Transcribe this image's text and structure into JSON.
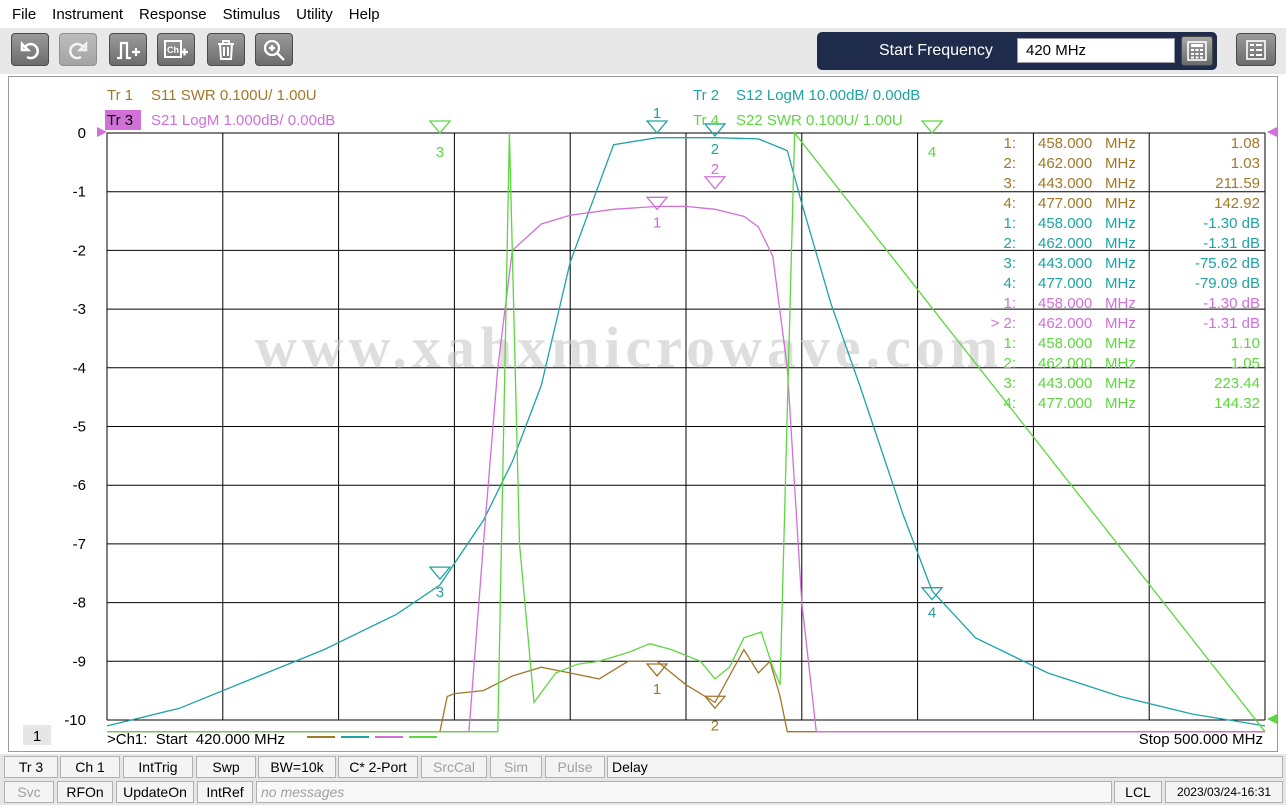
{
  "menu": [
    "File",
    "Instrument",
    "Response",
    "Stimulus",
    "Utility",
    "Help"
  ],
  "toolbar": {
    "buttons": [
      "undo-icon",
      "redo-icon",
      "marker-icon",
      "channel-icon",
      "trash-icon",
      "zoom-icon"
    ],
    "start_label": "Start Frequency",
    "start_value": "420 MHz"
  },
  "traces": {
    "tr1": {
      "id": "Tr  1",
      "desc": "S11 SWR 0.100U/  1.00U",
      "color": "#a0782a"
    },
    "tr2": {
      "id": "Tr  2",
      "desc": "S12 LogM 10.00dB/  0.00dB",
      "color": "#1fa3a3"
    },
    "tr3": {
      "id": "Tr  3",
      "desc": "S21 LogM 1.000dB/  0.00dB",
      "color": "#d070d8"
    },
    "tr4": {
      "id": "Tr  4",
      "desc": "S22 SWR 0.100U/  1.00U",
      "color": "#5ed640"
    }
  },
  "yticks": [
    "0",
    "-1",
    "-2",
    "-3",
    "-4",
    "-5",
    "-6",
    "-7",
    "-8",
    "-9",
    "-10"
  ],
  "marker_table": [
    {
      "n": "1:",
      "f": "458.000",
      "u": "MHz",
      "v": "1.08",
      "c": "#a0782a"
    },
    {
      "n": "2:",
      "f": "462.000",
      "u": "MHz",
      "v": "1.03",
      "c": "#a0782a"
    },
    {
      "n": "3:",
      "f": "443.000",
      "u": "MHz",
      "v": "211.59",
      "c": "#a0782a"
    },
    {
      "n": "4:",
      "f": "477.000",
      "u": "MHz",
      "v": "142.92",
      "c": "#a0782a"
    },
    {
      "n": "1:",
      "f": "458.000",
      "u": "MHz",
      "v": "-1.30 dB",
      "c": "#1fa3a3"
    },
    {
      "n": "2:",
      "f": "462.000",
      "u": "MHz",
      "v": "-1.31 dB",
      "c": "#1fa3a3"
    },
    {
      "n": "3:",
      "f": "443.000",
      "u": "MHz",
      "v": "-75.62 dB",
      "c": "#1fa3a3"
    },
    {
      "n": "4:",
      "f": "477.000",
      "u": "MHz",
      "v": "-79.09 dB",
      "c": "#1fa3a3"
    },
    {
      "n": "1:",
      "f": "458.000",
      "u": "MHz",
      "v": "-1.30 dB",
      "c": "#d070d8"
    },
    {
      "n": "> 2:",
      "f": "462.000",
      "u": "MHz",
      "v": "-1.31 dB",
      "c": "#d070d8"
    },
    {
      "n": "1:",
      "f": "458.000",
      "u": "MHz",
      "v": "1.10",
      "c": "#5ed640"
    },
    {
      "n": "2:",
      "f": "462.000",
      "u": "MHz",
      "v": "1.05",
      "c": "#5ed640"
    },
    {
      "n": "3:",
      "f": "443.000",
      "u": "MHz",
      "v": "223.44",
      "c": "#5ed640"
    },
    {
      "n": "4:",
      "f": "477.000",
      "u": "MHz",
      "v": "144.32",
      "c": "#5ed640"
    }
  ],
  "watermark": "www.xahxmicrowave.com",
  "footer": {
    "channel_num": "1",
    "start": ">Ch1:  Start  420.000 MHz",
    "stop": "Stop  500.000 MHz"
  },
  "status1": [
    "Tr 3",
    "Ch 1",
    "IntTrig",
    "Swp",
    "BW=10k",
    "C* 2-Port",
    "SrcCal",
    "Sim",
    "Pulse",
    "Delay"
  ],
  "status2": [
    "Svc",
    "RFOn",
    "UpdateOn",
    "IntRef",
    "no messages",
    "LCL",
    "2023/03/24-16:31"
  ],
  "chart_data": {
    "type": "line",
    "x_range_mhz": [
      420,
      500
    ],
    "ylim": [
      -10,
      0
    ],
    "yticks": [
      0,
      -1,
      -2,
      -3,
      -4,
      -5,
      -6,
      -7,
      -8,
      -9,
      -10
    ],
    "grid": true,
    "series": [
      {
        "name": "S11 SWR",
        "color": "#a0782a",
        "x": [
          420,
          443,
          443.5,
          444,
          446,
          448,
          450,
          452,
          454,
          456,
          458,
          460,
          462,
          464,
          465,
          465.8,
          466.5,
          467,
          477,
          500
        ],
        "y": [
          -10.2,
          -10.2,
          -9.6,
          -9.55,
          -9.5,
          -9.25,
          -9.1,
          -9.2,
          -9.3,
          -9.0,
          -9.0,
          -9.4,
          -9.7,
          -8.8,
          -9.2,
          -9.0,
          -9.6,
          -10.2,
          -10.2,
          -10.2
        ]
      },
      {
        "name": "S12 LogM",
        "color": "#1fa3a3",
        "x": [
          420,
          425,
          430,
          435,
          440,
          443,
          446,
          448,
          450,
          452,
          455,
          458,
          462,
          465,
          467,
          468,
          470,
          472,
          475,
          477,
          480,
          485,
          490,
          495,
          500
        ],
        "y": [
          -10.1,
          -9.8,
          -9.3,
          -8.8,
          -8.2,
          -7.7,
          -6.6,
          -5.6,
          -4.3,
          -2.2,
          -0.2,
          -0.08,
          -0.08,
          -0.1,
          -0.3,
          -1.2,
          -2.9,
          -4.3,
          -6.5,
          -7.8,
          -8.6,
          -9.2,
          -9.6,
          -9.9,
          -10.1
        ]
      },
      {
        "name": "S21 LogM",
        "color": "#d070d8",
        "x": [
          420,
          445,
          446,
          447,
          448,
          450,
          452,
          455,
          458,
          460,
          462,
          464,
          465,
          466,
          467,
          468,
          469,
          500
        ],
        "y": [
          -10.2,
          -10.2,
          -7,
          -4,
          -2,
          -1.55,
          -1.4,
          -1.3,
          -1.25,
          -1.25,
          -1.3,
          -1.42,
          -1.6,
          -2.1,
          -4,
          -8,
          -10.2,
          -10.2
        ]
      },
      {
        "name": "S22 SWR",
        "color": "#5ed640",
        "x": [
          420,
          447,
          447.8,
          448.5,
          449.5,
          451,
          452.5,
          454,
          456,
          457.5,
          459,
          461,
          462,
          463,
          464,
          465.2,
          466,
          466.5,
          467.5,
          500
        ],
        "y": [
          -10.2,
          -10.2,
          0,
          -7,
          -9.7,
          -9.2,
          -9.05,
          -9.0,
          -8.85,
          -8.7,
          -8.8,
          -9.0,
          -9.3,
          -9.1,
          -8.6,
          -8.5,
          -9.1,
          -9.4,
          0,
          -10.2
        ]
      }
    ],
    "markers": [
      {
        "trace": "Tr 2",
        "label": "1",
        "x": 458,
        "y": -1.3
      },
      {
        "trace": "Tr 2",
        "label": "2",
        "x": 462,
        "y": -1.31
      },
      {
        "trace": "Tr 2",
        "label": "3",
        "x": 443,
        "y": -75.62
      },
      {
        "trace": "Tr 2",
        "label": "4",
        "x": 477,
        "y": -79.09
      },
      {
        "trace": "Tr 3",
        "label": "1",
        "x": 458,
        "y": -1.3
      },
      {
        "trace": "Tr 3",
        "label": "2",
        "x": 462,
        "y": -1.31
      }
    ]
  }
}
